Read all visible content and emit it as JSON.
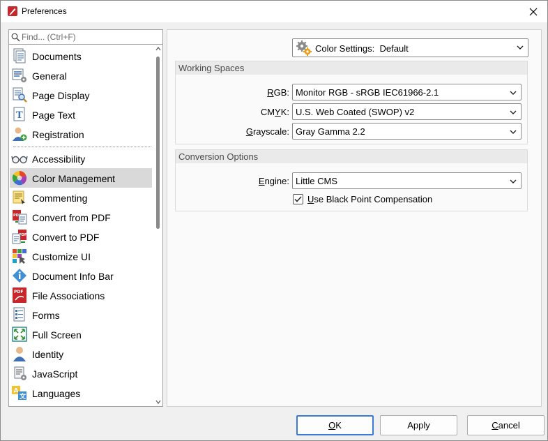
{
  "window": {
    "title": "Preferences",
    "app_icon": "pdf-app-icon",
    "close_icon": "close-icon"
  },
  "search": {
    "placeholder": "Find... (Ctrl+F)",
    "value": "",
    "icon": "search-icon"
  },
  "sidebar": {
    "items": [
      {
        "label": "Documents",
        "icon": "documents-icon"
      },
      {
        "label": "General",
        "icon": "general-settings-icon"
      },
      {
        "label": "Page Display",
        "icon": "page-display-icon"
      },
      {
        "label": "Page Text",
        "icon": "page-text-icon"
      },
      {
        "label": "Registration",
        "icon": "registration-user-icon"
      },
      {
        "label": "Accessibility",
        "icon": "accessibility-glasses-icon"
      },
      {
        "label": "Color Management",
        "icon": "color-wheel-icon",
        "selected": true
      },
      {
        "label": "Commenting",
        "icon": "commenting-icon"
      },
      {
        "label": "Convert from PDF",
        "icon": "convert-from-pdf-icon"
      },
      {
        "label": "Convert to PDF",
        "icon": "convert-to-pdf-icon"
      },
      {
        "label": "Customize UI",
        "icon": "customize-ui-icon"
      },
      {
        "label": "Document Info Bar",
        "icon": "info-icon"
      },
      {
        "label": "File Associations",
        "icon": "pdf-file-icon"
      },
      {
        "label": "Forms",
        "icon": "forms-icon"
      },
      {
        "label": "Full Screen",
        "icon": "full-screen-icon"
      },
      {
        "label": "Identity",
        "icon": "identity-user-icon"
      },
      {
        "label": "JavaScript",
        "icon": "javascript-scroll-icon"
      },
      {
        "label": "Languages",
        "icon": "languages-icon"
      }
    ]
  },
  "color_settings": {
    "label": "Color Settings:",
    "value": "Default",
    "icon": "gears-icon"
  },
  "working_spaces": {
    "title": "Working Spaces",
    "rgb": {
      "prefix": "",
      "mnemonic": "R",
      "rest": "GB:",
      "value": "Monitor RGB - sRGB IEC61966-2.1"
    },
    "cmyk": {
      "prefix": "CM",
      "mnemonic": "Y",
      "rest": "K:",
      "value": "U.S. Web Coated (SWOP) v2"
    },
    "grayscale": {
      "prefix": "",
      "mnemonic": "G",
      "rest": "rayscale:",
      "value": "Gray Gamma 2.2"
    }
  },
  "conversion_options": {
    "title": "Conversion Options",
    "engine": {
      "prefix": "",
      "mnemonic": "E",
      "rest": "ngine:",
      "value": "Little CMS"
    },
    "black_point": {
      "mnemonic": "U",
      "rest": "se Black Point Compensation",
      "checked": true
    }
  },
  "buttons": {
    "ok": {
      "mnemonic": "O",
      "rest": "K"
    },
    "apply": {
      "label": "Apply"
    },
    "cancel": {
      "mnemonic": "C",
      "rest": "ancel"
    }
  },
  "colors": {
    "selected_row": "#d9d9d9",
    "default_button_border": "#3a7bd5",
    "group_header": "#eaeaea"
  }
}
